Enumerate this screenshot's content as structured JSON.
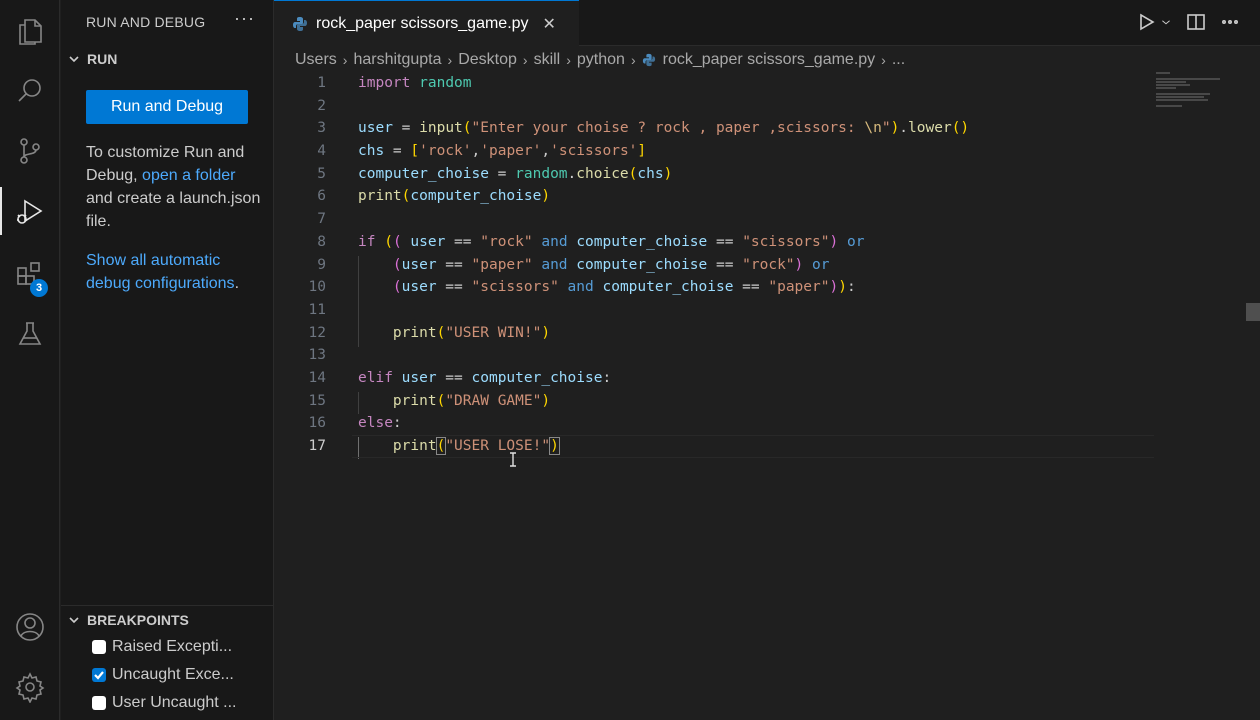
{
  "sidebar": {
    "title": "RUN AND DEBUG",
    "run_section": "RUN",
    "run_button": "Run and Debug",
    "customize": {
      "prefix": "To customize Run and Debug, ",
      "link": "open a folder",
      "suffix": " and create a launch.json file."
    },
    "show_all": {
      "link": "Show all automatic debug configurations",
      "suffix": "."
    },
    "breakpoints_section": "BREAKPOINTS",
    "breakpoints": [
      {
        "label": "Raised Excepti...",
        "checked": false
      },
      {
        "label": "Uncaught Exce...",
        "checked": true
      },
      {
        "label": "User Uncaught ...",
        "checked": false
      }
    ]
  },
  "activity_bar": {
    "items": [
      "explorer-icon",
      "search-icon",
      "source-control-icon",
      "run-debug-icon",
      "extensions-icon",
      "testing-icon"
    ],
    "extensions_badge": "3",
    "bottom": [
      "account-icon",
      "settings-gear-icon"
    ]
  },
  "editor": {
    "tab": "rock_paper scissors_game.py",
    "breadcrumb": [
      "Users",
      "harshitgupta",
      "Desktop",
      "skill",
      "python",
      "rock_paper scissors_game.py",
      "..."
    ],
    "line_numbers": [
      "1",
      "2",
      "3",
      "4",
      "5",
      "6",
      "7",
      "8",
      "9",
      "10",
      "11",
      "12",
      "13",
      "14",
      "15",
      "16",
      "17"
    ],
    "code": {
      "l1_kw": "import",
      "l1_mod": "random",
      "l3_var": "user",
      "l3_eq": " = ",
      "l3_fn": "input",
      "l3_str": "\"Enter your choise ? rock , paper ,scissors: ",
      "l3_esc": "\\n",
      "l3_strend": "\"",
      "l3_dot": ".",
      "l3_fn2": "lower",
      "l4_var": "chs",
      "l4_eq": " = ",
      "l4_s1": "'rock'",
      "l4_s2": "'paper'",
      "l4_s3": "'scissors'",
      "l5_var": "computer_choise",
      "l5_eq": " = ",
      "l5_mod": "random",
      "l5_dot": ".",
      "l5_fn": "choice",
      "l5_arg": "chs",
      "l6_fn": "print",
      "l6_arg": "computer_choise",
      "l8_kw": "if",
      "l8_v1": "user",
      "l8_eq": " == ",
      "l8_s1": "\"rock\"",
      "l8_and": "and",
      "l8_v2": "computer_choise",
      "l8_s2": "\"scissors\"",
      "l8_or": "or",
      "l9_v1": "user",
      "l9_s1": "\"paper\"",
      "l9_and": "and",
      "l9_v2": "computer_choise",
      "l9_s2": "\"rock\"",
      "l9_or": "or",
      "l10_v1": "user",
      "l10_s1": "\"scissors\"",
      "l10_and": "and",
      "l10_v2": "computer_choise",
      "l10_s2": "\"paper\"",
      "l10_colon": ":",
      "l12_fn": "print",
      "l12_str": "\"USER WIN!\"",
      "l14_kw": "elif",
      "l14_v1": "user",
      "l14_eq": " == ",
      "l14_v2": "computer_choise",
      "l14_colon": ":",
      "l15_fn": "print",
      "l15_str": "\"DRAW GAME\"",
      "l16_kw": "else",
      "l16_colon": ":",
      "l17_fn": "print",
      "l17_str": "\"USER LOSE!\""
    }
  },
  "colors": {
    "accent": "#0078d4",
    "link": "#4daafc",
    "background": "#1f1f1f"
  }
}
